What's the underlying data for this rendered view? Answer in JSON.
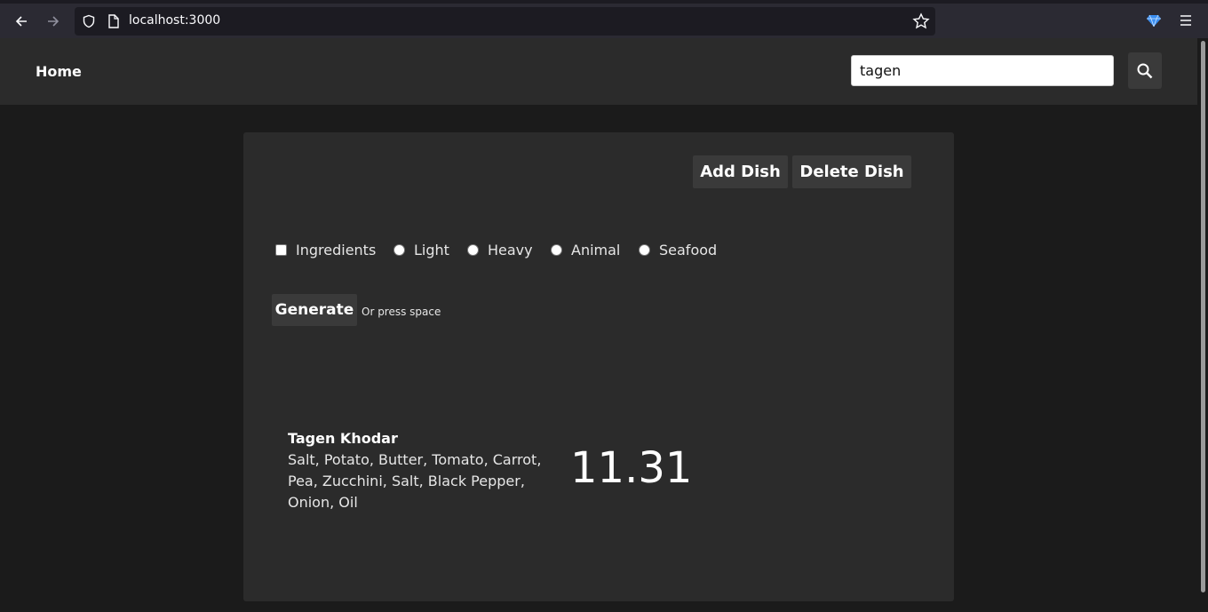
{
  "browser": {
    "url": "localhost:3000"
  },
  "header": {
    "home_label": "Home",
    "search_value": "tagen"
  },
  "actions": {
    "add_label": "Add Dish",
    "delete_label": "Delete Dish"
  },
  "filters": {
    "ingredients_label": "Ingredients",
    "light_label": "Light",
    "heavy_label": "Heavy",
    "animal_label": "Animal",
    "seafood_label": "Seafood"
  },
  "generate": {
    "label": "Generate",
    "hint": "Or press space"
  },
  "result": {
    "name": "Tagen Khodar",
    "ingredients": "Salt, Potato, Butter, Tomato, Carrot, Pea, Zucchini, Salt, Black Pepper, Onion, Oil",
    "price": "11.31"
  }
}
